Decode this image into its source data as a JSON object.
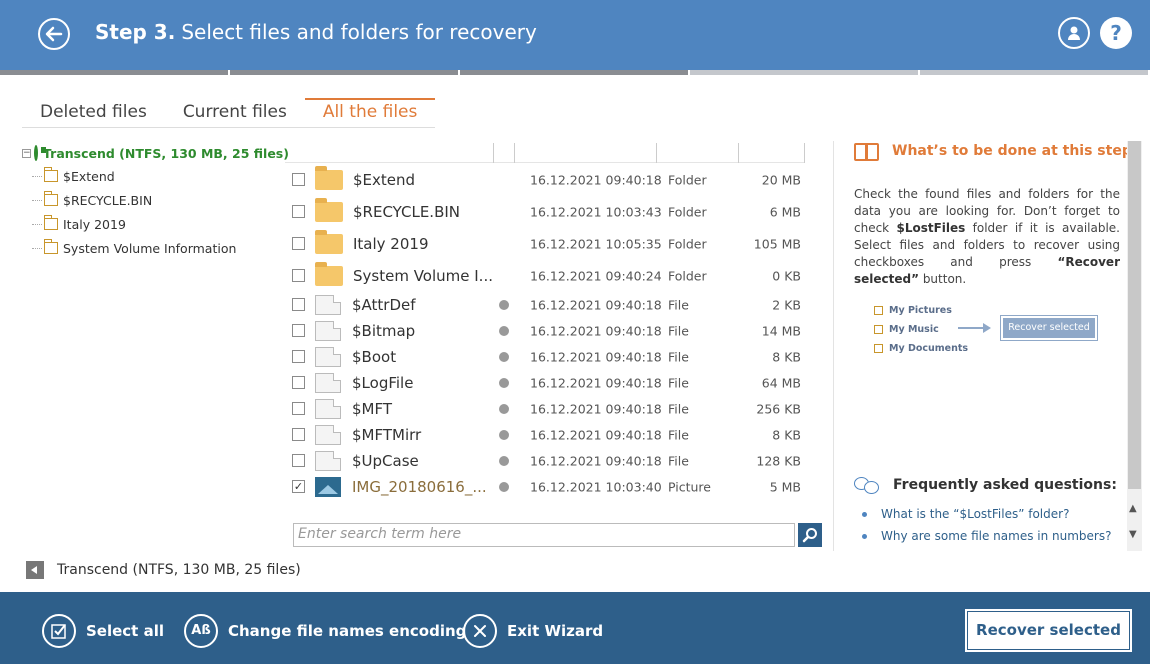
{
  "header": {
    "step_label": "Step 3.",
    "title": "Select files and folders for recovery"
  },
  "tabs": [
    "Deleted files",
    "Current files",
    "All the files"
  ],
  "active_tab": "All the files",
  "tree": {
    "root": "Transcend (NTFS, 130 MB, 25 files)",
    "items": [
      "$Extend",
      "$RECYCLE.BIN",
      "Italy 2019",
      "System Volume Information"
    ]
  },
  "files": [
    {
      "name": "$Extend",
      "date": "16.12.2021 09:40:18",
      "type": "Folder",
      "size": "20 MB",
      "kind": "folder",
      "checked": false
    },
    {
      "name": "$RECYCLE.BIN",
      "date": "16.12.2021 10:03:43",
      "type": "Folder",
      "size": "6 MB",
      "kind": "folder",
      "checked": false
    },
    {
      "name": "Italy 2019",
      "date": "16.12.2021 10:05:35",
      "type": "Folder",
      "size": "105 MB",
      "kind": "folder",
      "checked": false
    },
    {
      "name": "System Volume I...",
      "date": "16.12.2021 09:40:24",
      "type": "Folder",
      "size": "0 KB",
      "kind": "folder",
      "checked": false
    },
    {
      "name": "$AttrDef",
      "date": "16.12.2021 09:40:18",
      "type": "File",
      "size": "2 KB",
      "kind": "file",
      "checked": false
    },
    {
      "name": "$Bitmap",
      "date": "16.12.2021 09:40:18",
      "type": "File",
      "size": "14 MB",
      "kind": "file",
      "checked": false
    },
    {
      "name": "$Boot",
      "date": "16.12.2021 09:40:18",
      "type": "File",
      "size": "8 KB",
      "kind": "file",
      "checked": false
    },
    {
      "name": "$LogFile",
      "date": "16.12.2021 09:40:18",
      "type": "File",
      "size": "64 MB",
      "kind": "file",
      "checked": false
    },
    {
      "name": "$MFT",
      "date": "16.12.2021 09:40:18",
      "type": "File",
      "size": "256 KB",
      "kind": "file",
      "checked": false
    },
    {
      "name": "$MFTMirr",
      "date": "16.12.2021 09:40:18",
      "type": "File",
      "size": "8 KB",
      "kind": "file",
      "checked": false
    },
    {
      "name": "$UpCase",
      "date": "16.12.2021 09:40:18",
      "type": "File",
      "size": "128 KB",
      "kind": "file",
      "checked": false
    },
    {
      "name": "IMG_20180616_...",
      "date": "16.12.2021 10:03:40",
      "type": "Picture",
      "size": "5 MB",
      "kind": "picture",
      "checked": true
    }
  ],
  "search": {
    "placeholder": "Enter search term here"
  },
  "help": {
    "title": "What’s to be done at this step?",
    "text_1": "Check the found files and folders for the data you are looking for. Don’t forget to check ",
    "text_bold_1": "$LostFiles",
    "text_2": " folder if it is available. Select files and folders to recover using checkboxes and press ",
    "text_bold_2": "“Recover selected”",
    "text_3": " button.",
    "illustration": {
      "items": [
        "My Pictures",
        "My Music",
        "My Documents"
      ],
      "button": "Recover selected"
    },
    "faq_title": "Frequently asked questions:",
    "faq": [
      "What is the “$LostFiles” folder?",
      "Why are some file names in numbers?"
    ]
  },
  "status": "Transcend (NTFS, 130 MB, 25 files)",
  "footer": {
    "select_all": "Select all",
    "change_encoding": "Change file names encoding",
    "exit_wizard": "Exit Wizard",
    "recover_selected": "Recover selected",
    "encoding_icon_text": "Aß"
  },
  "help_button": "?",
  "colors": {
    "header": "#4f85c0",
    "footer": "#2e5f8a",
    "accent": "#e07b39",
    "tree_root": "#2e8b2e"
  }
}
